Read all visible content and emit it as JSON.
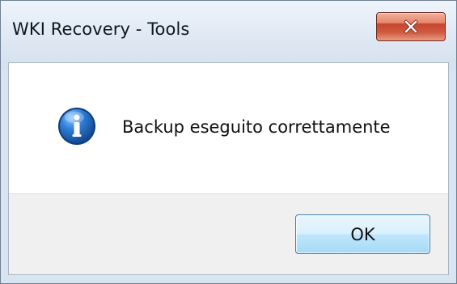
{
  "window": {
    "title": "WKI Recovery - Tools"
  },
  "dialog": {
    "message": "Backup eseguito correttamente",
    "icon": "info-icon",
    "ok_label": "OK"
  },
  "controls": {
    "close_icon": "close-icon"
  },
  "colors": {
    "close_button": "#c7462d",
    "ok_border": "#3c7fb1",
    "footer_background": "#f0f0f0",
    "info_icon": "#1d5ea8"
  }
}
